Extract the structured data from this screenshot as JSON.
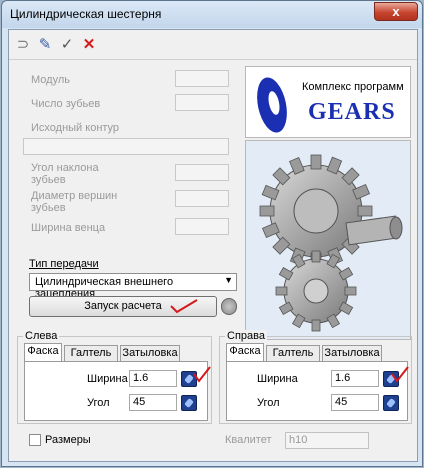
{
  "window": {
    "title": "Цилиндрическая шестерня",
    "close_label": "x"
  },
  "toolbar": {
    "icons": [
      "arrow-icon",
      "edit-icon",
      "checkmark-icon",
      "cross-icon"
    ],
    "glyphs": [
      "⊃",
      "✎",
      "✓",
      "✕"
    ]
  },
  "params": {
    "module": "Модуль",
    "teeth": "Число зубьев",
    "profile": "Исходный контур",
    "angle_l1": "Угол наклона",
    "angle_l2": "зубьев",
    "diam_l1": "Диаметр вершин",
    "diam_l2": "зубьев",
    "width": "Ширина венца"
  },
  "logo": {
    "subtitle": "Комплекс программ",
    "name": "GEARS"
  },
  "transmission": {
    "label": "Тип передачи",
    "selected": "Цилиндрическая внешнего зацепления",
    "arrow": "▼",
    "run_label": "Запуск расчета"
  },
  "left_group": {
    "title": "Слева",
    "tabs": [
      "Фаска",
      "Галтель",
      "Затыловка"
    ],
    "width_label": "Ширина",
    "width_value": "1.6",
    "angle_label": "Угол",
    "angle_value": "45"
  },
  "right_group": {
    "title": "Справа",
    "tabs": [
      "Фаска",
      "Галтель",
      "Затыловка"
    ],
    "width_label": "Ширина",
    "width_value": "1.6",
    "angle_label": "Угол",
    "angle_value": "45"
  },
  "bottom": {
    "sizes_label": "Размеры",
    "quality_label": "Квалитет",
    "quality_value": "h10"
  },
  "colors": {
    "logo_blue": "#1b2fb3",
    "annotation_red": "#d31a1a"
  }
}
